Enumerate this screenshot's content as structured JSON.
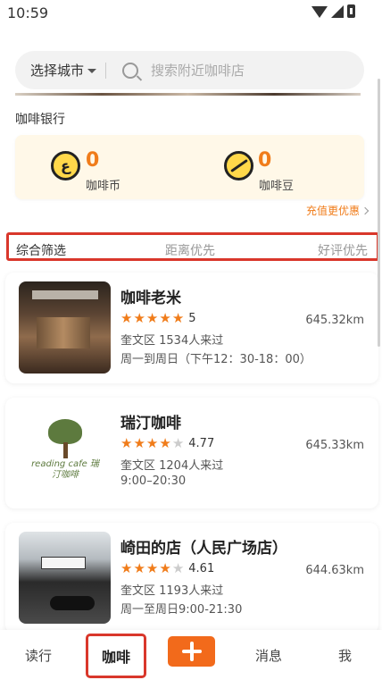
{
  "status_bar": {
    "time": "10:59"
  },
  "search": {
    "city_label": "选择城市",
    "placeholder": "搜索附近咖啡店"
  },
  "coffee_bank": {
    "title": "咖啡银行",
    "coins": {
      "value": "0",
      "label": "咖啡币",
      "icon": "coin-icon"
    },
    "beans": {
      "value": "0",
      "label": "咖啡豆",
      "icon": "bean-icon"
    },
    "recharge_link": "充值更优惠"
  },
  "filters": [
    "综合筛选",
    "距离优先",
    "好评优先"
  ],
  "shops": [
    {
      "name": "咖啡老米",
      "stars": 5,
      "rating": "5",
      "distance": "645.32km",
      "district_visits": "奎文区 1534人来过",
      "hours": "周一到周日（下午12：30-18：00）"
    },
    {
      "name": "瑞汀咖啡",
      "stars": 4,
      "rating": "4.77",
      "distance": "645.33km",
      "district_visits": "奎文区 1204人来过",
      "hours": "9:00–20:30",
      "logo_text": "reading cafe 瑞汀咖啡"
    },
    {
      "name": "崎田的店（人民广场店）",
      "stars": 4,
      "rating": "4.61",
      "distance": "644.63km",
      "district_visits": "奎文区 1193人来过",
      "hours": "周一至周日9:00-21:30"
    }
  ],
  "tabbar": {
    "read": "读行",
    "coffee": "咖啡",
    "messages": "消息",
    "me": "我"
  },
  "colors": {
    "accent": "#f07c1a",
    "highlight_border": "#d9372b",
    "add_button": "#f26a1b"
  }
}
